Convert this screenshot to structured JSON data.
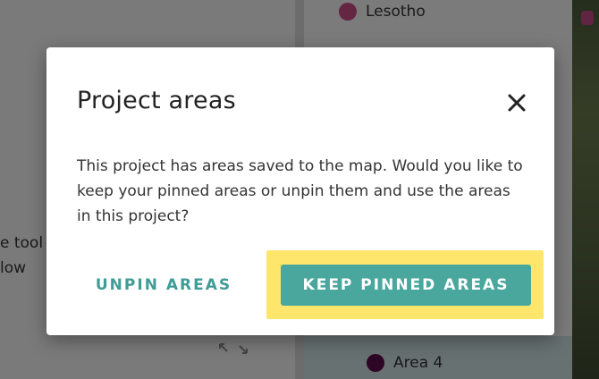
{
  "background": {
    "legend_top": {
      "label": "Lesotho",
      "color": "#c84c84"
    },
    "legend_bottom": {
      "label": "Area 4",
      "color": "#5a0a4a"
    },
    "snippet_line1": "e tool",
    "snippet_line2": "low"
  },
  "modal": {
    "title": "Project areas",
    "body": "This project has areas saved to the map. Would you like to keep your pinned areas or unpin them and use the areas in this project?",
    "unpin_label": "UNPIN AREAS",
    "keep_label": "KEEP PINNED AREAS"
  },
  "colors": {
    "accent": "#4aa79e",
    "highlight": "#fde66b"
  }
}
